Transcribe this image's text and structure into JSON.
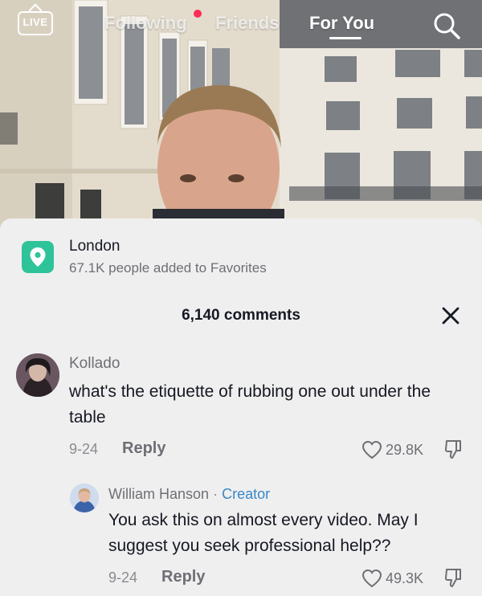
{
  "topbar": {
    "live_label": "LIVE",
    "tabs": [
      {
        "label": "Following",
        "active": false
      },
      {
        "label": "Friends",
        "active": false
      },
      {
        "label": "For You",
        "active": true
      }
    ],
    "notification_dot_color": "#fe2c55",
    "icons": {
      "live": "live-tv-icon",
      "search": "search-icon"
    }
  },
  "location": {
    "name": "London",
    "subtitle": "67.1K people added to Favorites",
    "icon": "location-pin-icon",
    "icon_color": "#2fc39a"
  },
  "comments": {
    "count_label": "6,140 comments",
    "close_icon": "close-icon",
    "items": [
      {
        "username": "Kollado",
        "text": "what's the etiquette of rubbing one out under the table",
        "date": "9-24",
        "reply_label": "Reply",
        "likes": "29.8K"
      },
      {
        "username": "William Hanson",
        "separator": "·",
        "badge": "Creator",
        "badge_color": "#3a87c8",
        "text": "You ask this on almost every video. May I suggest you seek professional help??",
        "date": "9-24",
        "reply_label": "Reply",
        "likes": "49.3K"
      }
    ]
  }
}
